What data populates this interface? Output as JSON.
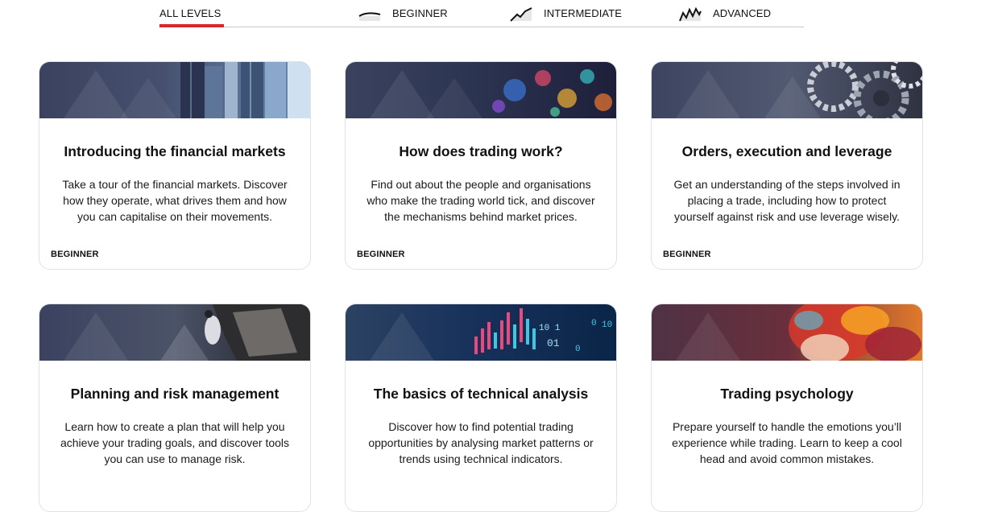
{
  "tabs": [
    {
      "label": "ALL LEVELS",
      "icon": "",
      "active": true
    },
    {
      "label": "BEGINNER",
      "icon": "beginner-level-icon",
      "active": false
    },
    {
      "label": "INTERMEDIATE",
      "icon": "intermediate-level-icon",
      "active": false
    },
    {
      "label": "ADVANCED",
      "icon": "advanced-level-icon",
      "active": false
    }
  ],
  "accent_color": "#d9272e",
  "courses": [
    {
      "title": "Introducing the financial markets",
      "description": "Take a tour of the financial markets. Discover how they operate, what drives them and how you can capitalise on their movements.",
      "level": "BEGINNER",
      "image": "city-skyscrapers-image"
    },
    {
      "title": "How does trading work?",
      "description": "Find out about the people and organisations who make the trading world tick, and discover the mechanisms behind market prices.",
      "level": "BEGINNER",
      "image": "market-screen-lights-image"
    },
    {
      "title": "Orders, execution and leverage",
      "description": "Get an understanding of the steps involved in placing a trade, including how to protect yourself against risk and use leverage wisely.",
      "level": "BEGINNER",
      "image": "gears-image"
    },
    {
      "title": "Planning and risk management",
      "description": "Learn how to create a plan that will help you achieve your trading goals, and discover tools you can use to manage risk.",
      "level": "",
      "image": "climber-image"
    },
    {
      "title": "The basics of technical analysis",
      "description": "Discover how to find potential trading opportunities by analysing market patterns or trends using technical indicators.",
      "level": "",
      "image": "candlestick-chart-image"
    },
    {
      "title": "Trading psychology",
      "description": "Prepare yourself to handle the emotions you’ll experience while trading. Learn to keep a cool head and avoid common mistakes.",
      "level": "",
      "image": "colorful-face-image"
    }
  ]
}
